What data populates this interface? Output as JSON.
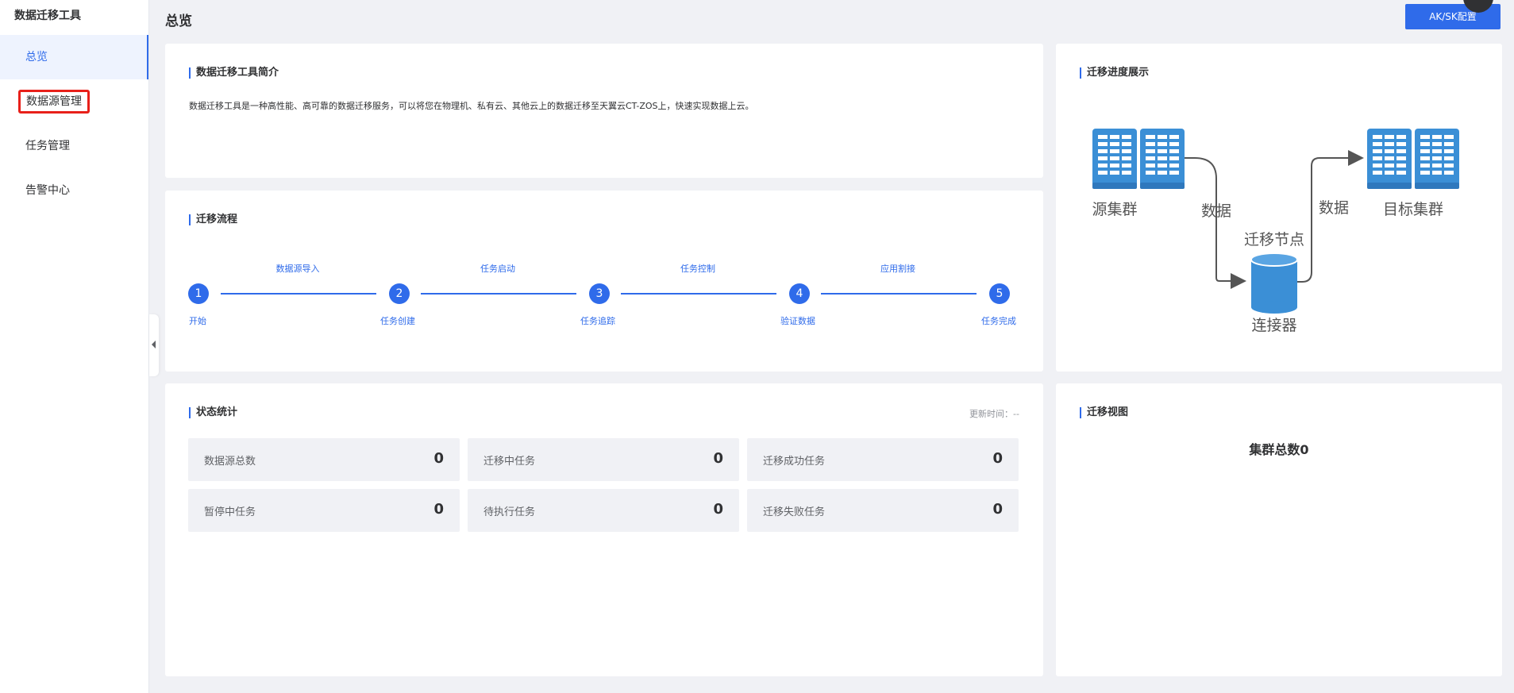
{
  "app_title": "数据迁移工具",
  "sidebar": {
    "items": [
      {
        "label": "总览"
      },
      {
        "label": "数据源管理"
      },
      {
        "label": "任务管理"
      },
      {
        "label": "告警中心"
      }
    ]
  },
  "header": {
    "title": "总览",
    "aksk_button": "AK/SK配置"
  },
  "intro": {
    "title": "数据迁移工具简介",
    "text": "数据迁移工具是一种高性能、高可靠的数据迁移服务，可以将您在物理机、私有云、其他云上的数据迁移至天翼云CT-ZOS上，快速实现数据上云。"
  },
  "flow": {
    "title": "迁移流程",
    "steps": [
      {
        "num": "1",
        "label": "开始"
      },
      {
        "num": "2",
        "label": "任务创建"
      },
      {
        "num": "3",
        "label": "任务追踪"
      },
      {
        "num": "4",
        "label": "验证数据"
      },
      {
        "num": "5",
        "label": "任务完成"
      }
    ],
    "transitions": [
      "数据源导入",
      "任务启动",
      "任务控制",
      "应用割接"
    ]
  },
  "progress": {
    "title": "迁移进度展示",
    "source_cluster": "源集群",
    "target_cluster": "目标集群",
    "data_left": "数据",
    "data_right": "数据",
    "node_label": "迁移节点",
    "connector": "连接器"
  },
  "stats": {
    "title": "状态统计",
    "update_time": "更新时间：--",
    "items": [
      {
        "label": "数据源总数",
        "value": "0"
      },
      {
        "label": "迁移中任务",
        "value": "0"
      },
      {
        "label": "迁移成功任务",
        "value": "0"
      },
      {
        "label": "暂停中任务",
        "value": "0"
      },
      {
        "label": "待执行任务",
        "value": "0"
      },
      {
        "label": "迁移失败任务",
        "value": "0"
      }
    ]
  },
  "view": {
    "title": "迁移视图",
    "cluster_total": "集群总数0"
  },
  "colors": {
    "primary": "#2f6bea",
    "highlight_border": "#e8201a",
    "server_blue": "#3b8fd6",
    "page_bg": "#f0f1f5"
  },
  "icons": [
    "server-icon",
    "database-icon",
    "collapse-arrow-icon"
  ]
}
